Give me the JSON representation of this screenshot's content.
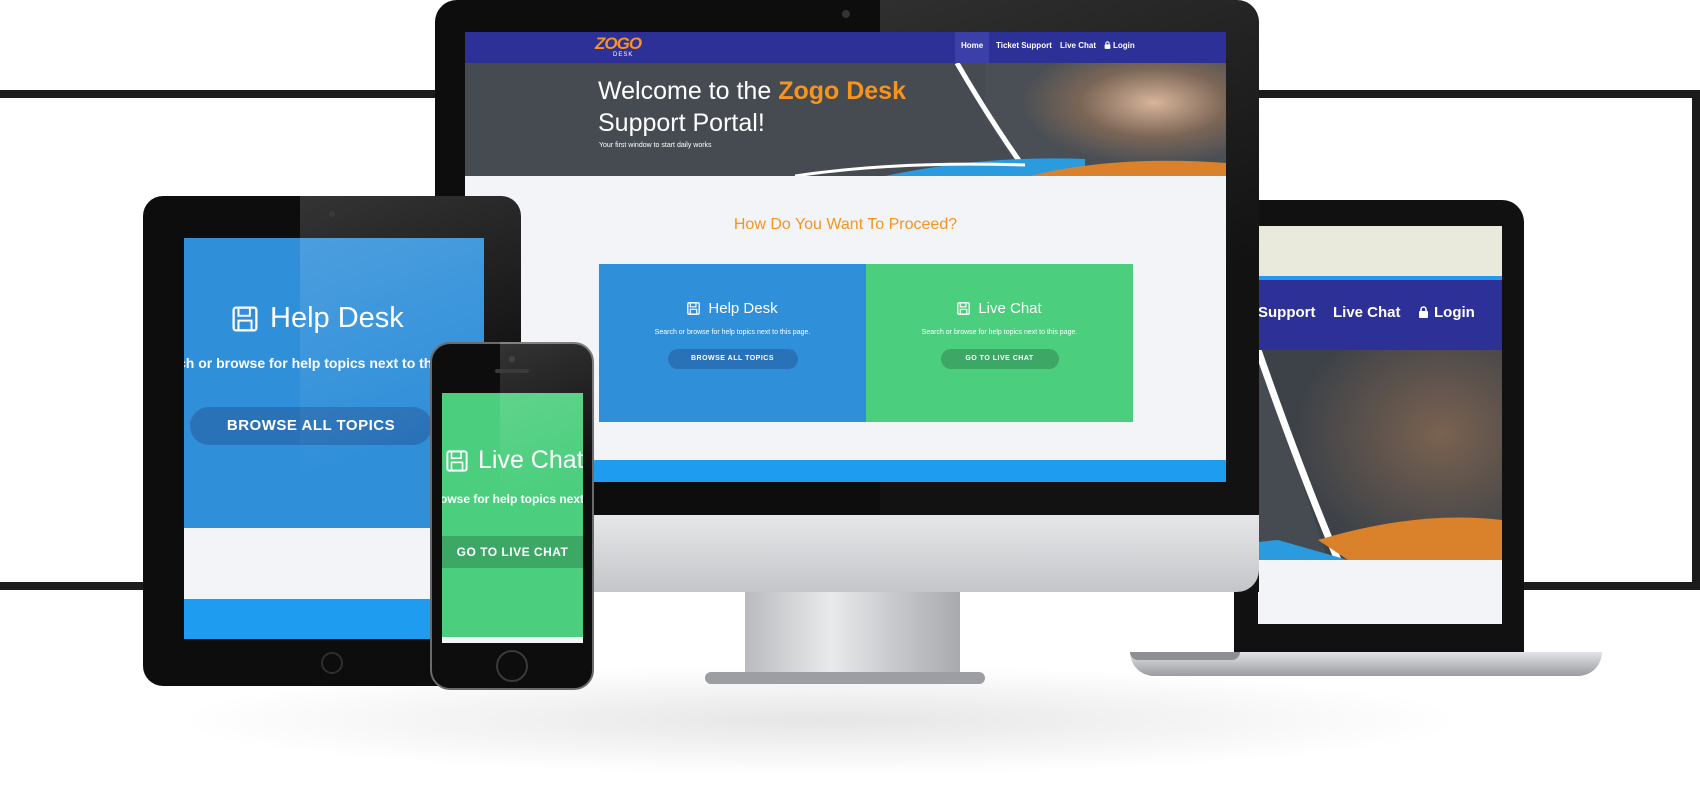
{
  "brand": {
    "logo": "ZOGO",
    "logo_sub": "DESK",
    "accent": "#f7941d",
    "nav_color": "#2d3096"
  },
  "nav": {
    "home": "Home",
    "ticket": "Ticket Support",
    "chat": "Live Chat",
    "login": "Login"
  },
  "laptop_nav": {
    "support": "Support",
    "chat": "Live Chat",
    "login": "Login"
  },
  "hero": {
    "title_prefix": "Welcome to the",
    "title_brand": "Zogo Desk",
    "title_suffix": "Support Portal!",
    "subtitle": "Your first window to start daily works"
  },
  "section": {
    "heading": "How Do You Want To Proceed?"
  },
  "cards": {
    "helpdesk": {
      "title": "Help Desk",
      "desc": "Search or browse for help topics next to this page.",
      "button": "BROWSE ALL TOPICS",
      "color": "#2f8fd9",
      "button_color": "#2a72b8"
    },
    "livechat": {
      "title": "Live Chat",
      "desc": "Search or browse for help topics next to this page.",
      "button": "GO TO LIVE CHAT",
      "color": "#4bce7d",
      "button_color": "#3da866"
    }
  },
  "tablet": {
    "title": "Help Desk",
    "desc": "ch or browse for help topics next to this",
    "button": "BROWSE ALL TOPICS"
  },
  "phone": {
    "title": "Live Chat",
    "desc": "owse for help topics next to",
    "button": "GO TO LIVE CHAT"
  },
  "icons": {
    "save": "floppy-disk-icon",
    "lock": "lock-icon"
  }
}
